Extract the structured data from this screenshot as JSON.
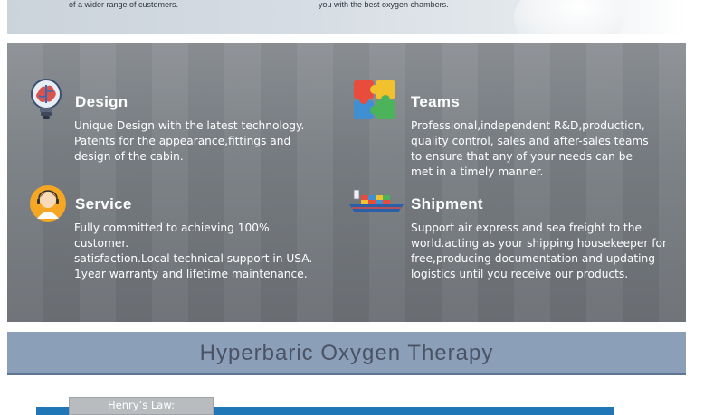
{
  "banner": {
    "caption_left": "of a wider range of customers.",
    "caption_right": "you with the best oxygen chambers."
  },
  "features": [
    {
      "title": "Design",
      "icon": "lightbulb-brain-icon",
      "lines": [
        "Unique Design with the latest technology.",
        "Patents for the appearance,fittings and",
        "design of the cabin."
      ]
    },
    {
      "title": "Teams",
      "icon": "puzzle-icon",
      "lines": [
        "Professional,independent R&D,production,",
        "quality control, sales and after-sales teams",
        "to ensure that any of your needs can be",
        "met in a timely manner."
      ]
    },
    {
      "title": "Service",
      "icon": "support-agent-icon",
      "lines": [
        "Fully committed to achieving 100%",
        "customer.",
        "satisfaction.Local technical support in USA.",
        "1year warranty and lifetime maintenance."
      ]
    },
    {
      "title": "Shipment",
      "icon": "cargo-ship-icon",
      "lines": [
        "Support air express and sea freight to the",
        "world.acting as your shipping housekeeper for",
        "free,producing documentation and updating",
        "logistics until you receive our products."
      ]
    }
  ],
  "section_title": "Hyperbaric Oxygen Therapy",
  "law_tab_label": "Henry’s Law:",
  "colors": {
    "title_bar": "#8c9fb9",
    "law_strip": "#1f77b8",
    "feature_text": "#ffffff"
  }
}
